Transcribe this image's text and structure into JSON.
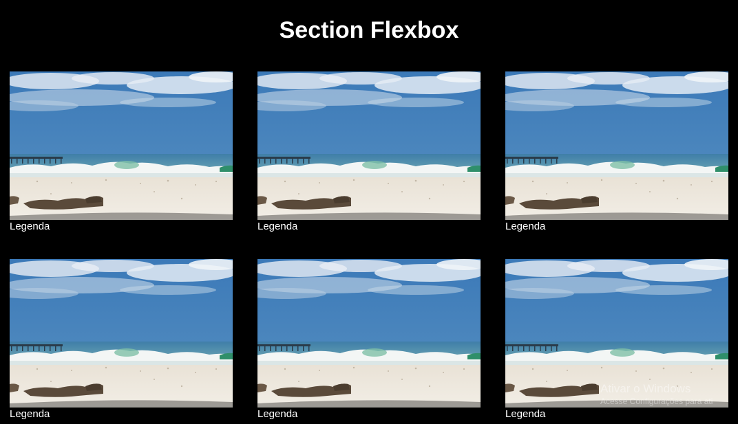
{
  "header": {
    "title": "Section Flexbox"
  },
  "gallery": {
    "items": [
      {
        "caption": "Legenda"
      },
      {
        "caption": "Legenda"
      },
      {
        "caption": "Legenda"
      },
      {
        "caption": "Legenda"
      },
      {
        "caption": "Legenda"
      },
      {
        "caption": "Legenda"
      }
    ]
  },
  "watermark": {
    "line1": "Ativar o Windows",
    "line2": "Acesse Configurações para ati"
  }
}
